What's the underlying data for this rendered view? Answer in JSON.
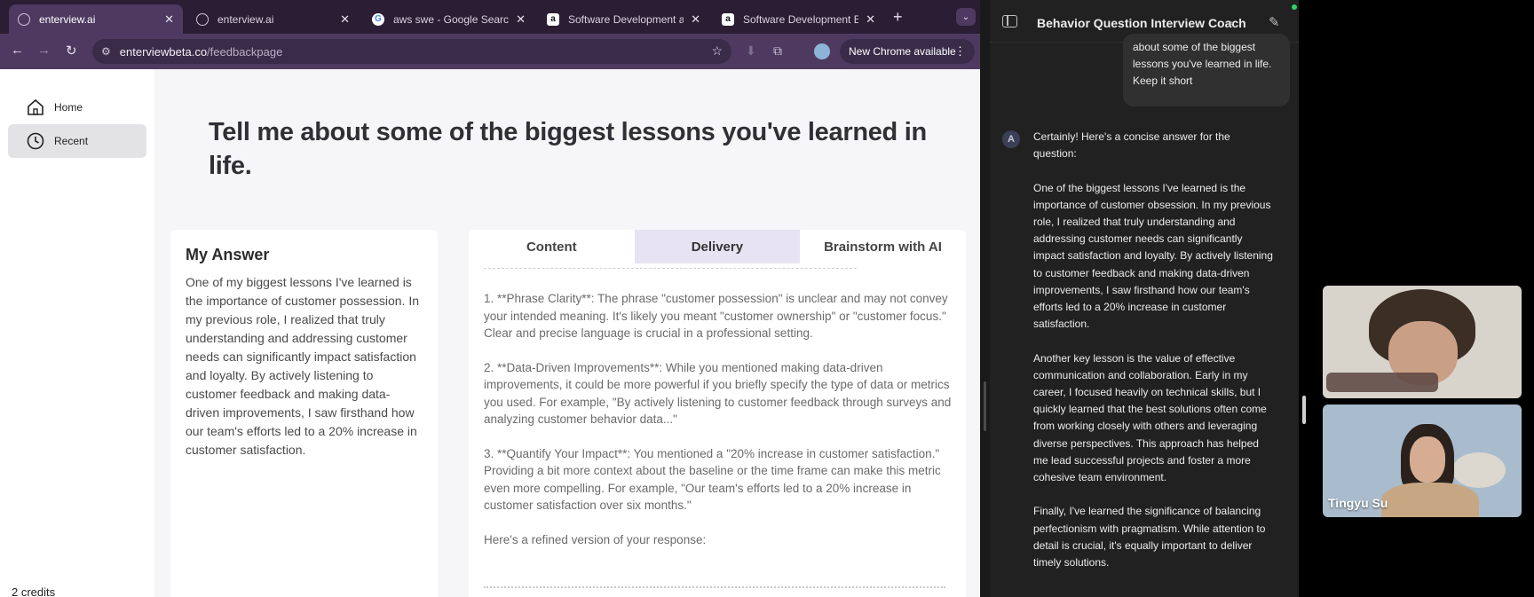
{
  "browser": {
    "tabs": [
      {
        "label": "enterview.ai",
        "favicon": "globe-icon"
      },
      {
        "label": "enterview.ai",
        "favicon": "globe-icon"
      },
      {
        "label": "aws swe - Google Search",
        "favicon": "google-icon"
      },
      {
        "label": "Software Development at A",
        "favicon": "amazon-icon"
      },
      {
        "label": "Software Development Eng",
        "favicon": "amazon-icon"
      }
    ],
    "url_host": "enterviewbeta.co",
    "url_path": "/feedbackpage",
    "update_label": "New Chrome available"
  },
  "sidebar": {
    "items": [
      {
        "label": "Home",
        "icon": "home-icon"
      },
      {
        "label": "Recent",
        "icon": "clock-icon"
      }
    ],
    "credits": "2 credits"
  },
  "question": "Tell me about some of the biggest lessons you've learned in life.",
  "answer": {
    "title": "My Answer",
    "text": "One of my biggest lessons I've learned is the importance of customer possession. In my previous role, I realized that truly understanding and addressing customer needs can significantly impact satisfaction and loyalty. By actively listening to customer feedback and making data-driven improvements, I saw firsthand how our team's efforts led to a 20% increase in customer satisfaction."
  },
  "feedback": {
    "tabs": [
      "Content",
      "Delivery",
      "Brainstorm with AI"
    ],
    "active_tab": 1,
    "paragraphs": [
      "1. **Phrase Clarity**: The phrase \"customer possession\" is unclear and may not convey your intended meaning. It's likely you meant \"customer ownership\" or \"customer focus.\" Clear and precise language is crucial in a professional setting.",
      "2. **Data-Driven Improvements**: While you mentioned making data-driven improvements, it could be more powerful if you briefly specify the type of data or metrics you used. For example, \"By actively listening to customer feedback through surveys and analyzing customer behavior data...\"",
      "3. **Quantify Your Impact**: You mentioned a \"20% increase in customer satisfaction.\" Providing a bit more context about the baseline or the time frame can make this metric even more compelling. For example, \"Our team's efforts led to a 20% increase in customer satisfaction over six months.\"",
      "Here's a refined version of your response:"
    ]
  },
  "chat": {
    "title": "Behavior Question Interview Coach",
    "user_message": "about some of the biggest lessons you've learned in life. Keep it short",
    "assistant_paragraphs": [
      "Certainly! Here's a concise answer for the question:",
      "One of the biggest lessons I've learned is the importance of customer obsession. In my previous role, I realized that truly understanding and addressing customer needs can significantly impact satisfaction and loyalty. By actively listening to customer feedback and making data-driven improvements, I saw firsthand how our team's efforts led to a 20% increase in customer satisfaction.",
      "Another key lesson is the value of effective communication and collaboration. Early in my career, I focused heavily on technical skills, but I quickly learned that the best solutions often come from working closely with others and leveraging diverse perspectives. This approach has helped me lead successful projects and foster a more cohesive team environment.",
      "Finally, I've learned the significance of balancing perfectionism with pragmatism. While attention to detail is crucial, it's equally important to deliver timely solutions."
    ]
  },
  "video": {
    "participant_2_name": "Tingyu Su"
  }
}
